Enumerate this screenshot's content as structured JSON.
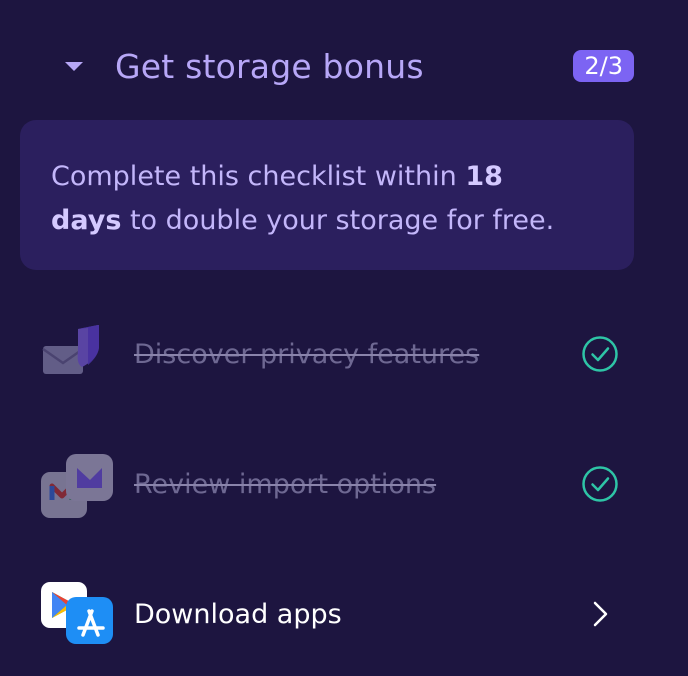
{
  "checklist": {
    "title": "Get storage bonus",
    "progress_badge": "2/3",
    "progress": {
      "completed": 2,
      "total": 3
    },
    "collapse_icon": "caret-down-icon",
    "info": {
      "text_before": "Complete this checklist within ",
      "days_value": "18",
      "days_unit": "days",
      "text_after": " to double your storage for free."
    },
    "items": [
      {
        "label": "Discover privacy features",
        "done": true,
        "icon": "privacy-shield-icon",
        "status_icon": "check-circle-icon"
      },
      {
        "label": "Review import options",
        "done": true,
        "icon": "import-mail-icon",
        "status_icon": "check-circle-icon"
      },
      {
        "label": "Download apps",
        "done": false,
        "icon": "app-stores-icon",
        "status_icon": "chevron-right-icon"
      }
    ]
  },
  "colors": {
    "background": "#1d1540",
    "card": "#2b1f5e",
    "accent": "#7c64f3",
    "header_text": "#b7a7f7",
    "success": "#2ec4a6"
  }
}
